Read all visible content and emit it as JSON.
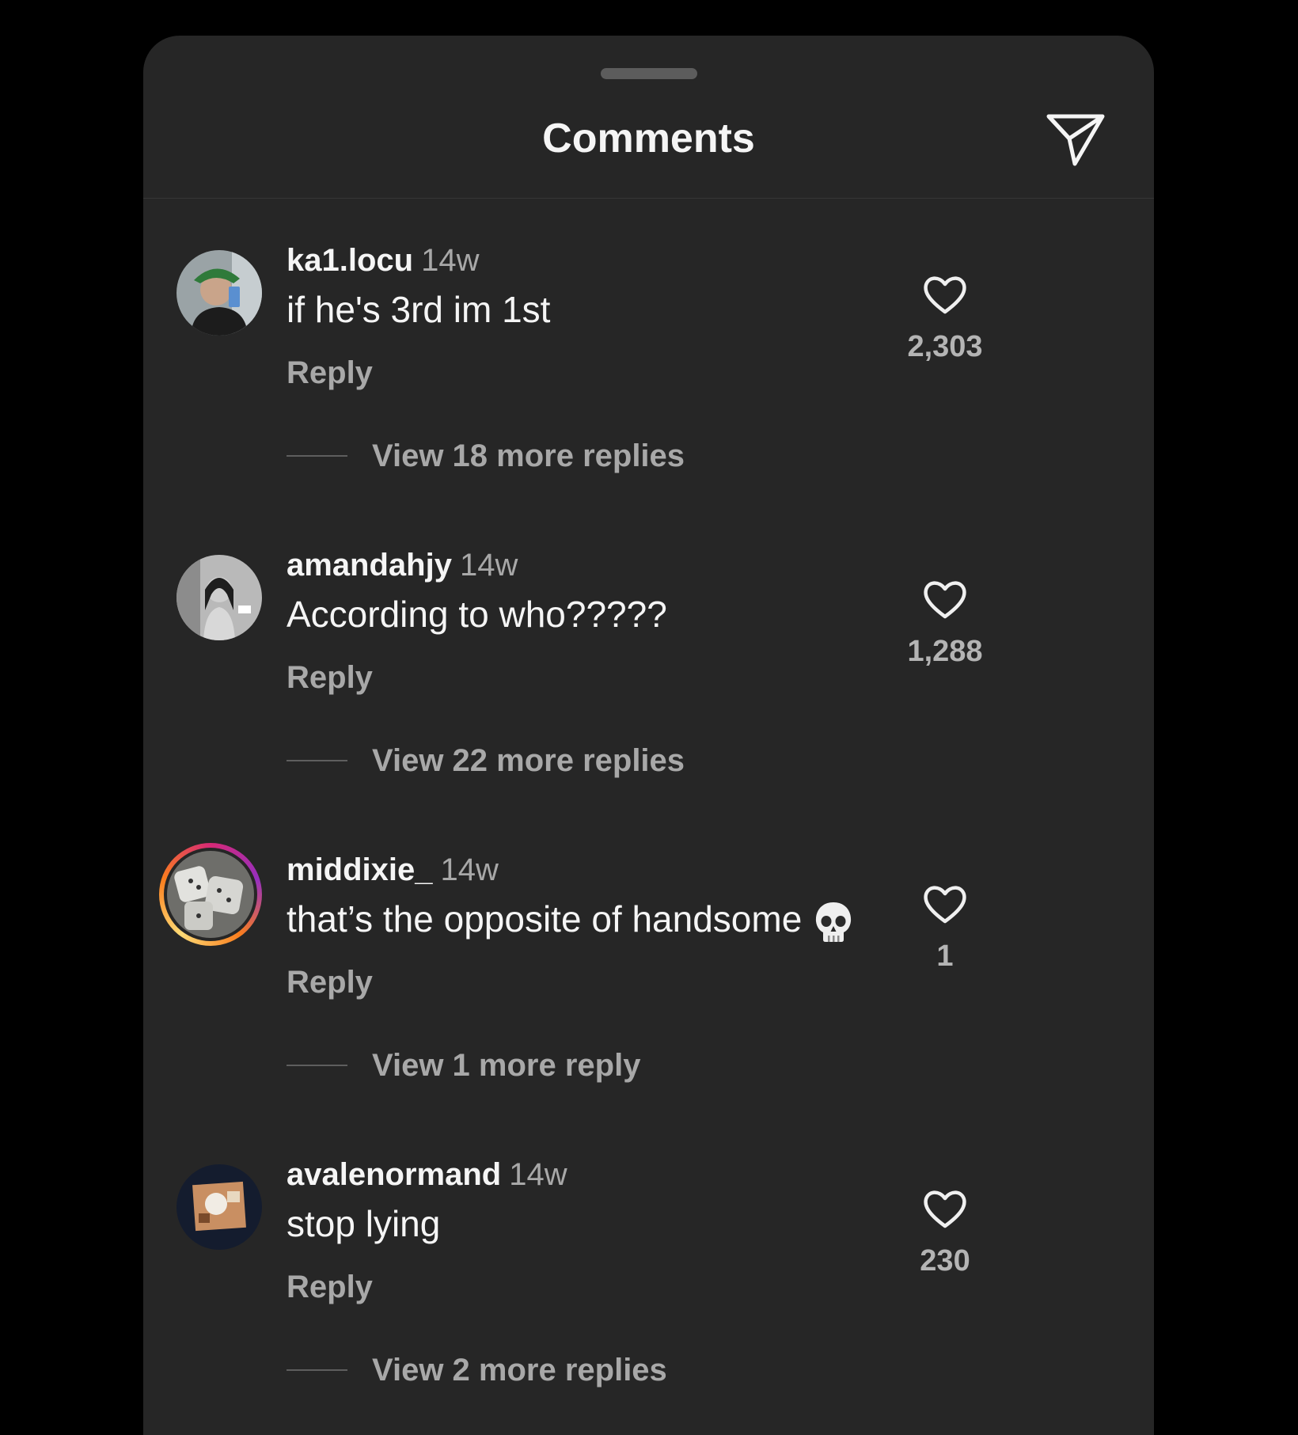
{
  "header": {
    "title": "Comments",
    "share_icon": "paper-plane-icon"
  },
  "comments": [
    {
      "username": "ka1.locu",
      "time": "14w",
      "text": "if he's 3rd im 1st",
      "reply_label": "Reply",
      "view_more": "View 18 more replies",
      "likes": "2,303",
      "avatar": "selfie-photo-green-hat"
    },
    {
      "username": "amandahjy",
      "time": "14w",
      "text": "According to who?????",
      "reply_label": "Reply",
      "view_more": "View 22 more replies",
      "likes": "1,288",
      "avatar": "grayscale-portrait-photo"
    },
    {
      "username": "middixie_",
      "time": "14w",
      "text": "that’s the opposite of handsome",
      "emoji": "skull-emoji",
      "reply_label": "Reply",
      "view_more": "View 1 more reply",
      "likes": "1",
      "avatar": "dice-photo",
      "has_story_ring": true
    },
    {
      "username": "avalenormand",
      "time": "14w",
      "text": "stop lying",
      "reply_label": "Reply",
      "view_more": "View 2 more replies",
      "likes": "230",
      "avatar": "food-photo"
    }
  ],
  "colors": {
    "background": "#000000",
    "sheet": "#262626",
    "primary_text": "#f5f5f5",
    "secondary_text": "#a8a8a8"
  }
}
